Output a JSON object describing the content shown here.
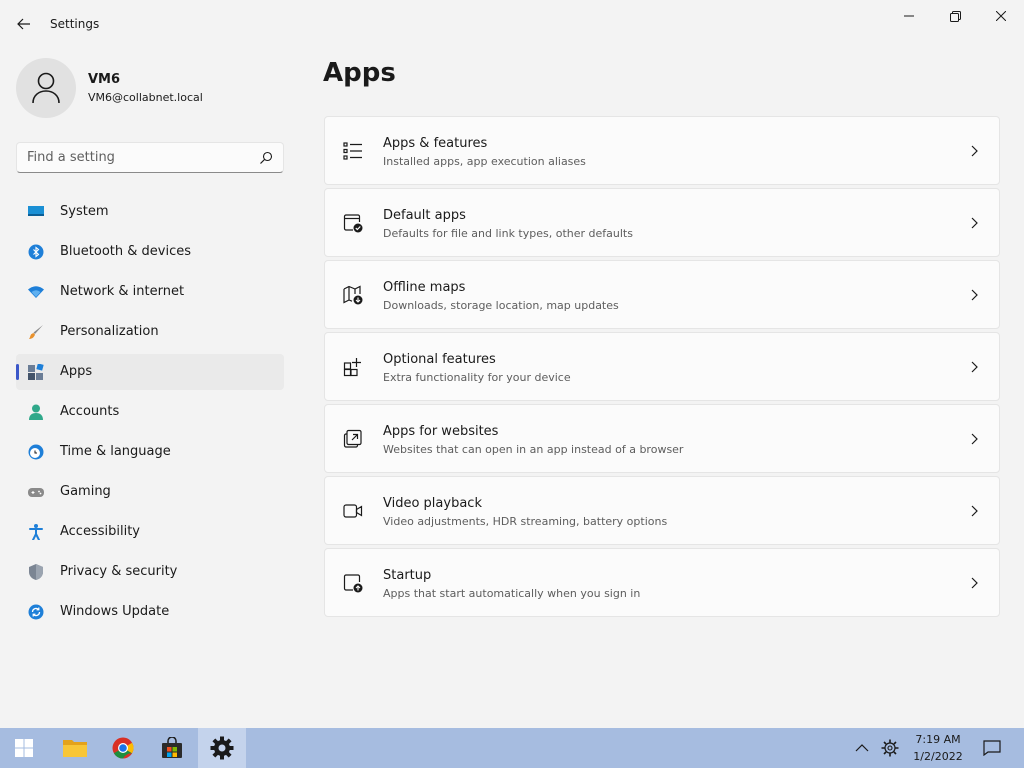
{
  "window": {
    "title": "Settings"
  },
  "profile": {
    "name": "VM6",
    "email": "VM6@collabnet.local"
  },
  "search": {
    "placeholder": "Find a setting",
    "value": ""
  },
  "sidebar": {
    "items": [
      {
        "label": "System",
        "icon": "monitor-icon",
        "active": false
      },
      {
        "label": "Bluetooth & devices",
        "icon": "bluetooth-icon",
        "active": false
      },
      {
        "label": "Network & internet",
        "icon": "wifi-icon",
        "active": false
      },
      {
        "label": "Personalization",
        "icon": "brush-icon",
        "active": false
      },
      {
        "label": "Apps",
        "icon": "apps-icon",
        "active": true
      },
      {
        "label": "Accounts",
        "icon": "person-icon",
        "active": false
      },
      {
        "label": "Time & language",
        "icon": "clock-globe-icon",
        "active": false
      },
      {
        "label": "Gaming",
        "icon": "gamepad-icon",
        "active": false
      },
      {
        "label": "Accessibility",
        "icon": "accessibility-icon",
        "active": false
      },
      {
        "label": "Privacy & security",
        "icon": "shield-icon",
        "active": false
      },
      {
        "label": "Windows Update",
        "icon": "update-icon",
        "active": false
      }
    ]
  },
  "main": {
    "title": "Apps",
    "cards": [
      {
        "title": "Apps & features",
        "desc": "Installed apps, app execution aliases",
        "icon": "list-icon"
      },
      {
        "title": "Default apps",
        "desc": "Defaults for file and link types, other defaults",
        "icon": "default-apps-icon"
      },
      {
        "title": "Offline maps",
        "desc": "Downloads, storage location, map updates",
        "icon": "map-download-icon"
      },
      {
        "title": "Optional features",
        "desc": "Extra functionality for your device",
        "icon": "add-grid-icon"
      },
      {
        "title": "Apps for websites",
        "desc": "Websites that can open in an app instead of a browser",
        "icon": "open-external-icon"
      },
      {
        "title": "Video playback",
        "desc": "Video adjustments, HDR streaming, battery options",
        "icon": "video-icon"
      },
      {
        "title": "Startup",
        "desc": "Apps that start automatically when you sign in",
        "icon": "startup-icon"
      }
    ]
  },
  "taskbar": {
    "time": "7:19 AM",
    "date": "1/2/2022",
    "apps": [
      "start-icon",
      "file-explorer-icon",
      "chrome-icon",
      "store-icon",
      "settings-icon"
    ]
  },
  "colors": {
    "accent": "#3b57c9",
    "taskbar": "#a6bce0",
    "background": "#f3f3f3"
  }
}
